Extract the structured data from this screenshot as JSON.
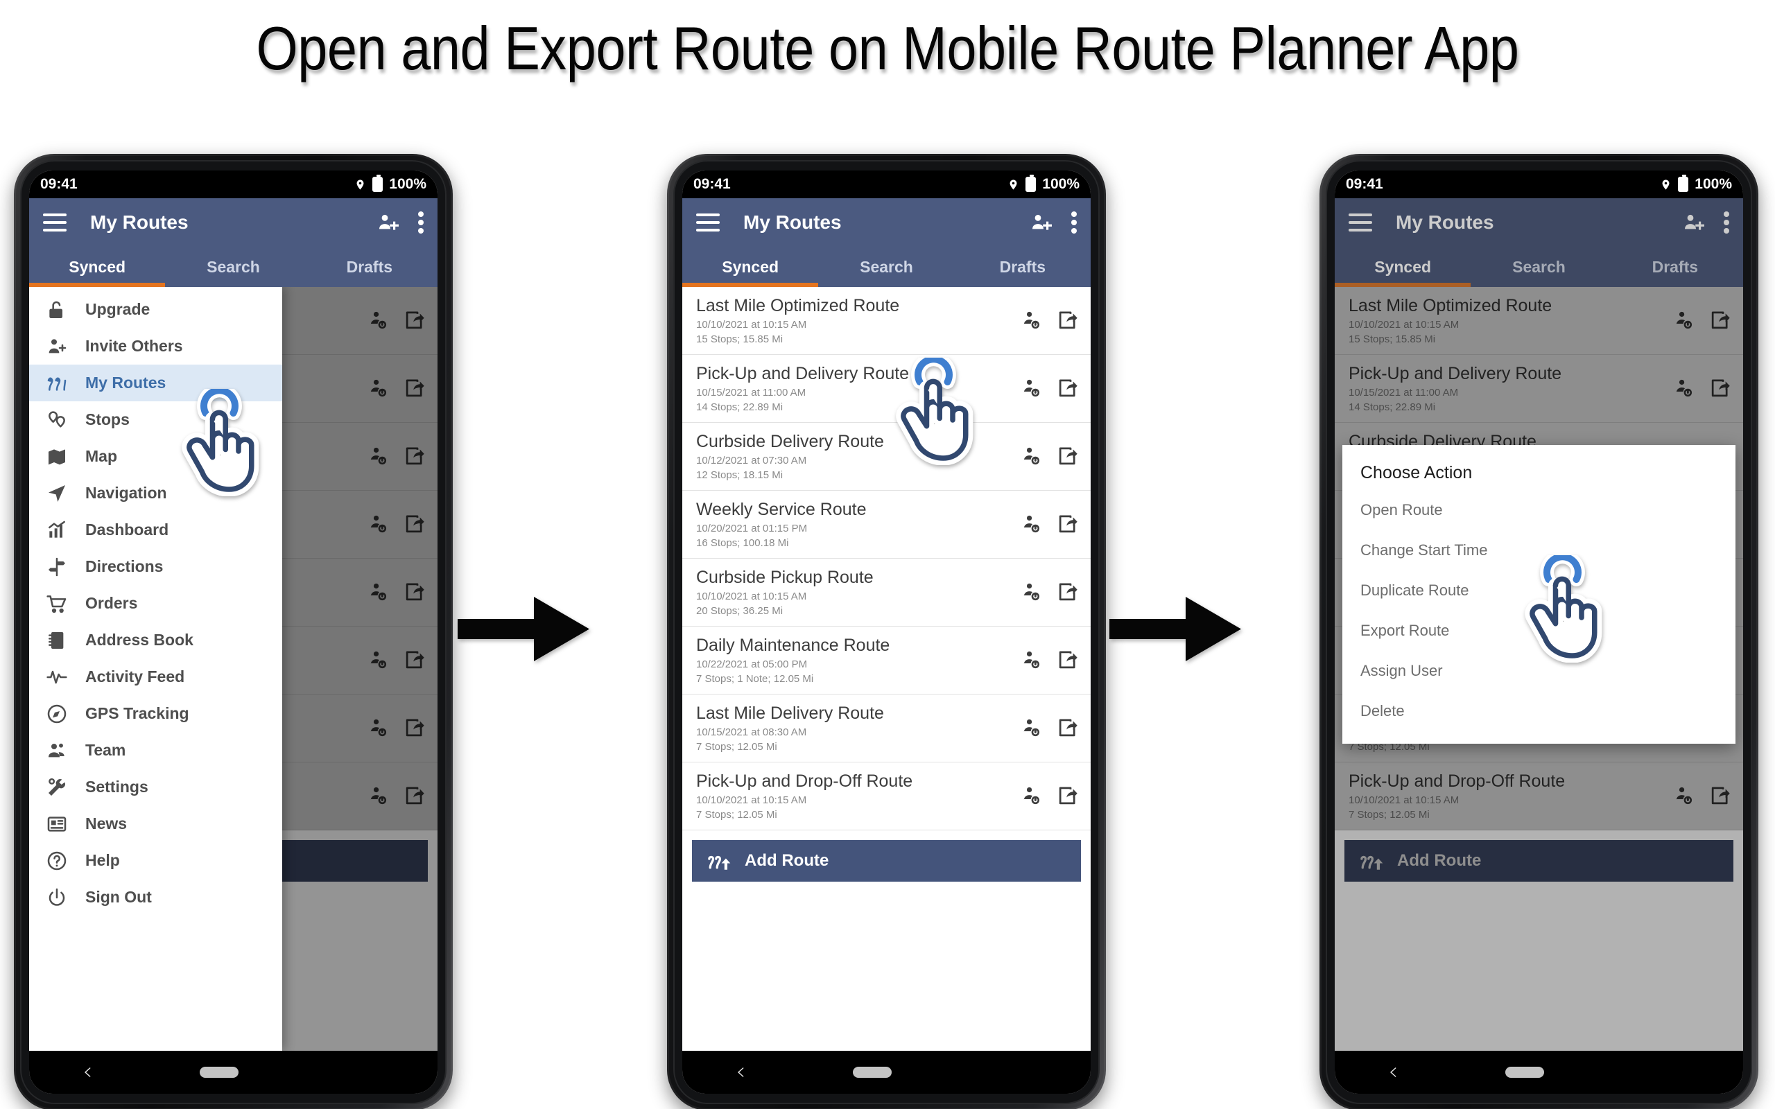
{
  "page": {
    "title": "Open and Export Route on Mobile Route Planner App"
  },
  "status_bar": {
    "time": "09:41",
    "battery": "100%",
    "location_icon": "location-pin-icon",
    "battery_icon": "battery-full-icon"
  },
  "app_bar": {
    "title": "My Routes",
    "menu_icon": "hamburger-menu-icon",
    "add_user_icon": "person-add-icon",
    "overflow_icon": "overflow-menu-icon"
  },
  "tabs": [
    {
      "label": "Synced",
      "active": true
    },
    {
      "label": "Search",
      "active": false
    },
    {
      "label": "Drafts",
      "active": false
    }
  ],
  "drawer": {
    "items": [
      {
        "label": "Upgrade",
        "icon": "unlock-icon",
        "active": false
      },
      {
        "label": "Invite Others",
        "icon": "person-add-icon",
        "active": false
      },
      {
        "label": "My Routes",
        "icon": "routes-icon",
        "active": true
      },
      {
        "label": "Stops",
        "icon": "map-pins-icon",
        "active": false
      },
      {
        "label": "Map",
        "icon": "map-folded-icon",
        "active": false
      },
      {
        "label": "Navigation",
        "icon": "navigation-arrow-icon",
        "active": false
      },
      {
        "label": "Dashboard",
        "icon": "bar-chart-icon",
        "active": false
      },
      {
        "label": "Directions",
        "icon": "signpost-icon",
        "active": false
      },
      {
        "label": "Orders",
        "icon": "shopping-cart-icon",
        "active": false
      },
      {
        "label": "Address Book",
        "icon": "notebook-icon",
        "active": false
      },
      {
        "label": "Activity Feed",
        "icon": "pulse-icon",
        "active": false
      },
      {
        "label": "GPS Tracking",
        "icon": "gps-compass-icon",
        "active": false
      },
      {
        "label": "Team",
        "icon": "people-icon",
        "active": false
      },
      {
        "label": "Settings",
        "icon": "wrench-gear-icon",
        "active": false
      },
      {
        "label": "News",
        "icon": "newspaper-icon",
        "active": false
      },
      {
        "label": "Help",
        "icon": "question-circle-icon",
        "active": false
      },
      {
        "label": "Sign Out",
        "icon": "power-icon",
        "active": false
      }
    ]
  },
  "routes": [
    {
      "name": "Last Mile Optimized Route",
      "datetime": "10/10/2021 at 10:15 AM",
      "stats": "15 Stops; 15.85 Mi"
    },
    {
      "name": "Pick-Up and Delivery Route",
      "datetime": "10/15/2021 at 11:00 AM",
      "stats": "14 Stops; 22.89 Mi"
    },
    {
      "name": "Curbside Delivery Route",
      "datetime": "10/12/2021 at 07:30 AM",
      "stats": "12 Stops; 18.15 Mi"
    },
    {
      "name": "Weekly Service Route",
      "datetime": "10/20/2021 at 01:15 PM",
      "stats": "16 Stops; 100.18 Mi"
    },
    {
      "name": "Curbside Pickup Route",
      "datetime": "10/10/2021 at 10:15 AM",
      "stats": "20 Stops; 36.25 Mi"
    },
    {
      "name": "Daily Maintenance Route",
      "datetime": "10/22/2021 at 05:00 PM",
      "stats": "7 Stops; 1 Note; 12.05 Mi"
    },
    {
      "name": "Last Mile Delivery Route",
      "datetime": "10/15/2021 at 08:30 AM",
      "stats": "7 Stops; 12.05 Mi"
    },
    {
      "name": "Pick-Up and Drop-Off Route",
      "datetime": "10/10/2021 at 10:15 AM",
      "stats": "7 Stops; 12.05 Mi"
    }
  ],
  "route_row_icons": {
    "assign": "assign-user-icon",
    "export": "export-share-icon"
  },
  "add_route": {
    "label": "Add Route",
    "icon": "add-route-icon"
  },
  "dialog": {
    "title": "Choose Action",
    "items": [
      {
        "label": "Open Route"
      },
      {
        "label": "Change Start Time"
      },
      {
        "label": "Duplicate Route"
      },
      {
        "label": "Export Route"
      },
      {
        "label": "Assign User"
      },
      {
        "label": "Delete"
      }
    ]
  },
  "nav_bar": {
    "back_icon": "back-chevron-icon",
    "home_icon": "home-pill-icon"
  },
  "flow": {
    "arrow_icon": "right-arrow-icon"
  },
  "cursors": {
    "tap_icon": "hand-tap-cursor-icon"
  },
  "colors": {
    "app_bar": "#4b5a80",
    "tab_indicator": "#e4741f",
    "add_route_button": "#44547b",
    "drawer_active_bg": "#dce8f5",
    "drawer_active_fg": "#3e6ea8",
    "cursor_blue": "#3f7fd0",
    "cursor_navy": "#31486f"
  }
}
